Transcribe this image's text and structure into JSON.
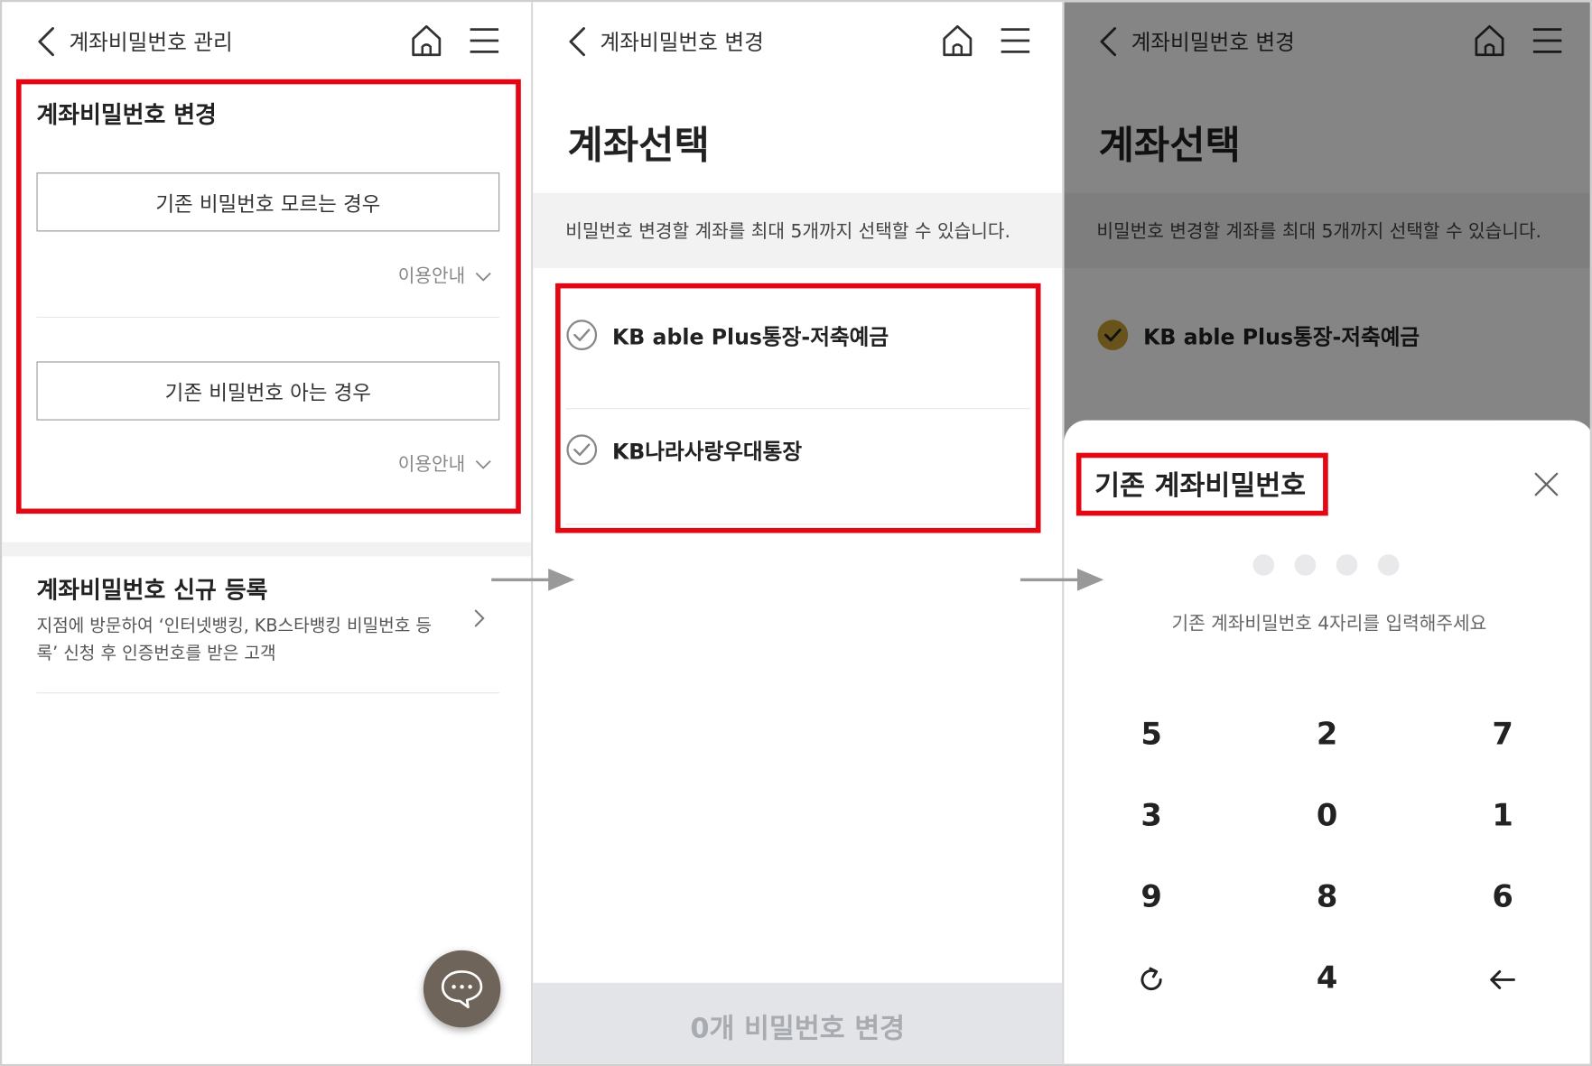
{
  "screen1": {
    "header_title": "계좌비밀번호 관리",
    "section_title": "계좌비밀번호 변경",
    "btn_forgot": "기존 비밀번호 모르는 경우",
    "btn_know": "기존 비밀번호 아는 경우",
    "guide_label": "이용안내",
    "register_title": "계좌비밀번호 신규 등록",
    "register_desc": "지점에 방문하여 ‘인터넷뱅킹, KB스타뱅킹 비밀번호 등록’ 신청 후 인증번호를 받은 고객"
  },
  "screen2": {
    "header_title": "계좌비밀번호 변경",
    "page_title": "계좌선택",
    "notice": "비밀번호 변경할 계좌를 최대 5개까지 선택할 수 있습니다.",
    "accounts": [
      {
        "name": "KB able Plus통장-저축예금"
      },
      {
        "name": "KB나라사랑우대통장"
      }
    ],
    "submit_label": "0개 비밀번호 변경"
  },
  "screen3": {
    "header_title": "계좌비밀번호 변경",
    "page_title": "계좌선택",
    "notice": "비밀번호 변경할 계좌를 최대 5개까지 선택할 수 있습니다.",
    "selected_account": "KB able Plus통장-저축예금",
    "sheet_title": "기존 계좌비밀번호",
    "pin_hint": "기존 계좌비밀번호 4자리를 입력해주세요",
    "pin_length": 4,
    "keypad": [
      "5",
      "2",
      "7",
      "3",
      "0",
      "1",
      "9",
      "8",
      "6",
      "refresh-icon",
      "4",
      "backspace-icon"
    ]
  },
  "colors": {
    "highlight": "#e30613",
    "check_selected": "#c8a132",
    "chat_button": "#6e645a",
    "disabled_button": "#e2e4e8"
  }
}
